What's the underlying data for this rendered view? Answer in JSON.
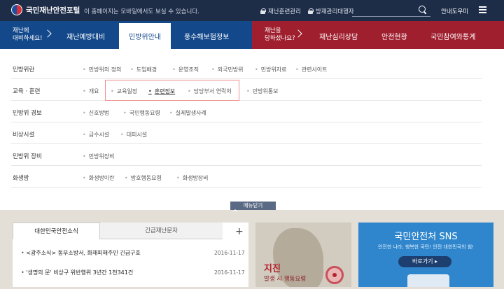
{
  "header": {
    "logo_text": "국민재난안전포털",
    "notice": "이 홈페이지는 모바일에서도 보실 수 있습니다.",
    "links": [
      "재난훈련관리",
      "방재관리대행자"
    ],
    "search_placeholder": "",
    "help": "안내도우미"
  },
  "nav": {
    "left_note": "재난에\n대비하세요!",
    "left_items": [
      "재난예방대비",
      "민방위안내",
      "풍수해보험정보"
    ],
    "active": "민방위안내",
    "right_note": "재난을\n당하셨나요?",
    "right_items": [
      "재난심리상담",
      "안전현황",
      "국민참여와통계"
    ]
  },
  "mega_menu": {
    "rows": [
      {
        "label": "민방위란",
        "items": [
          "민방위의 정의",
          "도입배경",
          "운영조직",
          "외국민방위",
          "민방위자료",
          "관련사이트"
        ]
      },
      {
        "label": "교육 · 훈련",
        "items": [
          "개요",
          "교육일정",
          "훈련정보",
          "담당부서 연락처",
          "민방위통보"
        ]
      },
      {
        "label": "민방위 경보",
        "items": [
          "신호방법",
          "국민행동요령",
          "실제발생사례"
        ]
      },
      {
        "label": "비상시설",
        "items": [
          "급수시설",
          "대피시설"
        ]
      },
      {
        "label": "민방위 장비",
        "items": [
          "민방위장비"
        ]
      },
      {
        "label": "화생방",
        "items": [
          "화생방이란",
          "방호행동요령",
          "화생방장비"
        ]
      }
    ],
    "current_item": "훈련정보",
    "close_label": "메뉴닫기"
  },
  "news": {
    "tabs": [
      "대한민국안전소식",
      "긴급재난문자"
    ],
    "items": [
      {
        "title": "<광주소식> 동부소방서, 화재피해주민 긴급구호",
        "date": "2016-11-17"
      },
      {
        "title": "'생명의 문' 비상구 위반행위 3년간 1천341건",
        "date": "2016-11-17"
      }
    ]
  },
  "disaster": {
    "title": "지진",
    "subtitle": "발생 시 행동요령"
  },
  "sns": {
    "title": "국민안전처 SNS",
    "subtitle": "안전한 나라, 행복한 국민! 안전 대한민국의 힘!",
    "button": "바로가기"
  }
}
